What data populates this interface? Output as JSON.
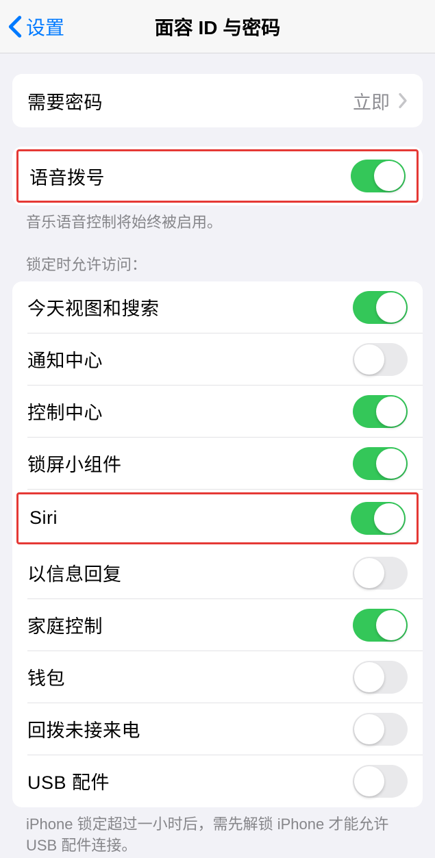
{
  "nav": {
    "back_label": "设置",
    "title": "面容 ID 与密码"
  },
  "groups": {
    "passcode": {
      "require_label": "需要密码",
      "require_value": "立即"
    },
    "voice": {
      "label": "语音拨号",
      "footer": "音乐语音控制将始终被启用。"
    },
    "lockscreen": {
      "header": "锁定时允许访问：",
      "items": {
        "today": "今天视图和搜索",
        "notifications": "通知中心",
        "control_center": "控制中心",
        "lock_widgets": "锁屏小组件",
        "siri": "Siri",
        "reply_message": "以信息回复",
        "home_control": "家庭控制",
        "wallet": "钱包",
        "callback": "回拨未接来电",
        "usb": "USB 配件"
      },
      "footer": "iPhone 锁定超过一小时后，需先解锁 iPhone 才能允许USB 配件连接。"
    }
  }
}
